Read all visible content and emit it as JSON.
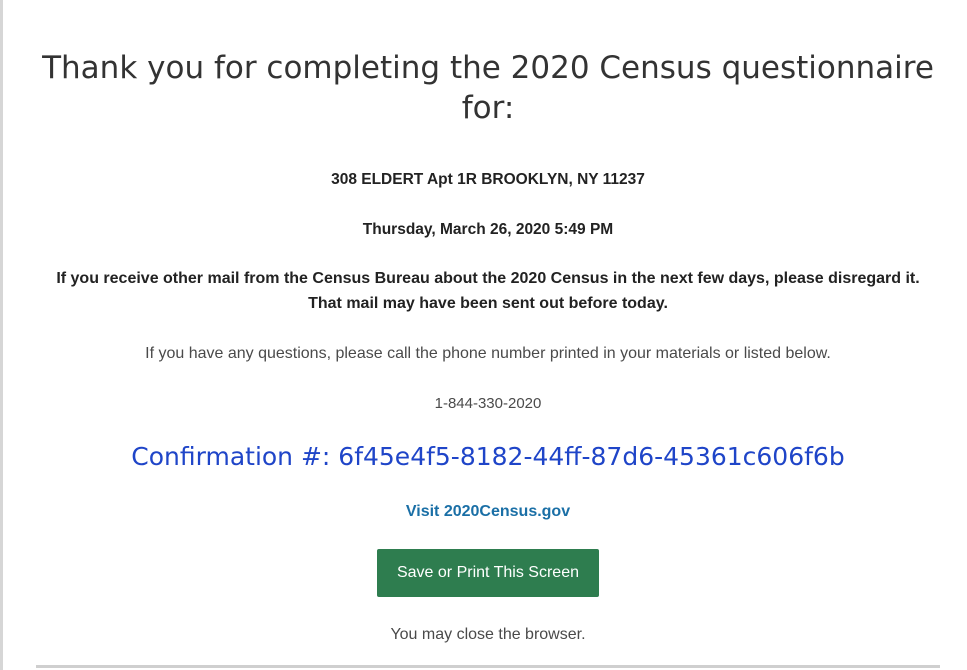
{
  "heading": "Thank you for completing the 2020 Census questionnaire for:",
  "address": "308 ELDERT Apt 1R BROOKLYN, NY 11237",
  "datetime": "Thursday, March 26, 2020 5:49 PM",
  "notice": "If you receive other mail from the Census Bureau about the 2020 Census in the next few days, please disregard it. That mail may have been sent out before today.",
  "questions_text": "If you have any questions, please call the phone number printed in your materials or listed below.",
  "phone": "1-844-330-2020",
  "confirmation": "Confirmation #: 6f45e4f5-8182-44ff-87d6-45361c606f6b",
  "visit_link": "Visit 2020Census.gov",
  "save_button": "Save or Print This Screen",
  "close_note": "You may close the browser.",
  "colors": {
    "confirmation": "#1f45c8",
    "link": "#1a6fa6",
    "button": "#2e7d4f"
  }
}
